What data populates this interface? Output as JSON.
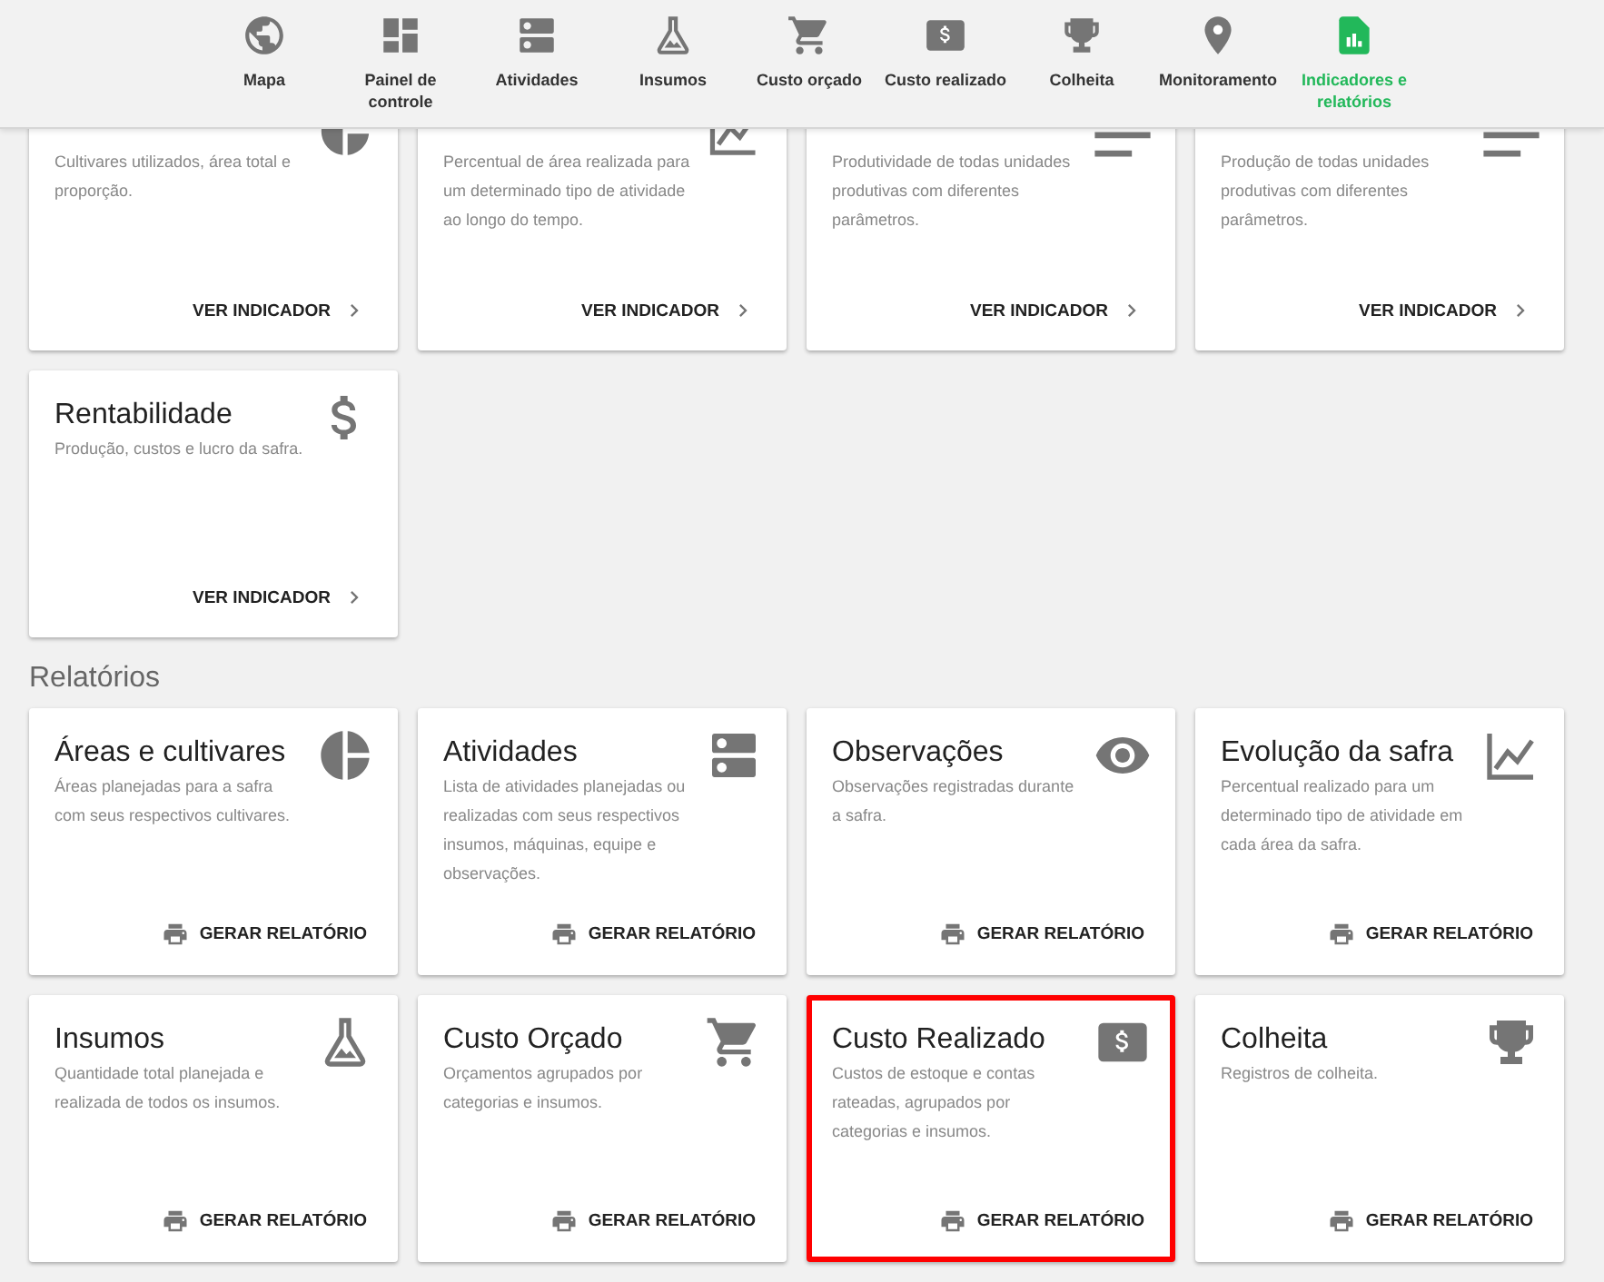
{
  "nav": [
    {
      "label": "Mapa",
      "kind": "globe",
      "selected": false
    },
    {
      "label": "Painel de controle",
      "kind": "dashboard",
      "selected": false
    },
    {
      "label": "Atividades",
      "kind": "server",
      "selected": false
    },
    {
      "label": "Insumos",
      "kind": "flask",
      "selected": false
    },
    {
      "label": "Custo orçado",
      "kind": "cart",
      "selected": false
    },
    {
      "label": "Custo realizado",
      "kind": "money",
      "selected": false
    },
    {
      "label": "Colheita",
      "kind": "trophy",
      "selected": false
    },
    {
      "label": "Monitoramento",
      "kind": "pin",
      "selected": false
    },
    {
      "label": "Indicadores e relatórios",
      "kind": "report",
      "selected": true
    }
  ],
  "indicators": [
    {
      "description": "Cultivares utilizados, área total e proporção.",
      "kind": "pie",
      "action": "VER INDICADOR",
      "highlighted": false
    },
    {
      "description": "Percentual de área realizada para um determinado tipo de atividade ao longo do tempo.",
      "kind": "chart",
      "action": "VER INDICADOR",
      "highlighted": false
    },
    {
      "description": "Produtividade de todas unidades produtivas com diferentes parâmetros.",
      "kind": "lines",
      "action": "VER INDICADOR",
      "highlighted": false
    },
    {
      "description": "Produção de todas unidades produtivas com diferentes parâmetros.",
      "kind": "lines",
      "action": "VER INDICADOR",
      "highlighted": false
    },
    {
      "title": "Rentabilidade",
      "description": "Produção, custos e lucro da safra.",
      "kind": "dollar",
      "action": "VER INDICADOR",
      "highlighted": false
    }
  ],
  "reports_title": "Relatórios",
  "reports": [
    {
      "title": "Áreas e cultivares",
      "description": "Áreas planejadas para a safra com seus respectivos cultivares.",
      "kind": "pie",
      "action": "GERAR RELATÓRIO",
      "highlighted": false
    },
    {
      "title": "Atividades",
      "description": "Lista de atividades planejadas ou realizadas com seus respectivos insumos, máquinas, equipe e observações.",
      "kind": "server",
      "action": "GERAR RELATÓRIO",
      "highlighted": false
    },
    {
      "title": "Observações",
      "description": "Observações registradas durante a safra.",
      "kind": "eye",
      "action": "GERAR RELATÓRIO",
      "highlighted": false
    },
    {
      "title": "Evolução da safra",
      "description": "Percentual realizado para um determinado tipo de atividade em cada área da safra.",
      "kind": "chart",
      "action": "GERAR RELATÓRIO",
      "highlighted": false
    },
    {
      "title": "Insumos",
      "description": "Quantidade total planejada e realizada de todos os insumos.",
      "kind": "flask",
      "action": "GERAR RELATÓRIO",
      "highlighted": false
    },
    {
      "title": "Custo Orçado",
      "description": "Orçamentos agrupados por categorias e insumos.",
      "kind": "cart",
      "action": "GERAR RELATÓRIO",
      "highlighted": false
    },
    {
      "title": "Custo Realizado",
      "description": "Custos de estoque e contas rateadas, agrupados por categorias e insumos.",
      "kind": "money",
      "action": "GERAR RELATÓRIO",
      "highlighted": true
    },
    {
      "title": "Colheita",
      "description": "Registros de colheita.",
      "kind": "trophy",
      "action": "GERAR RELATÓRIO",
      "highlighted": false
    }
  ]
}
